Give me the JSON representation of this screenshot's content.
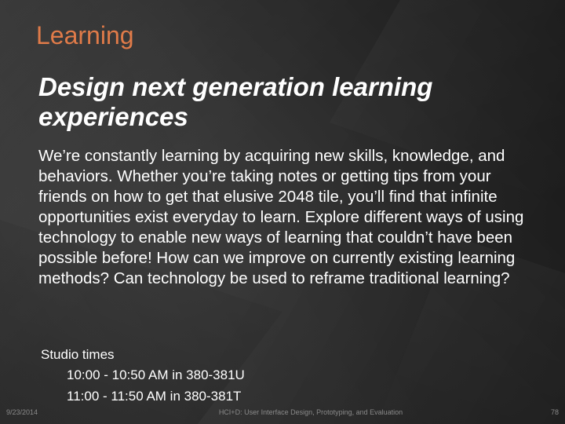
{
  "slide": {
    "section_title": "Learning",
    "headline": "Design next generation learning experiences",
    "body": "We’re constantly learning by acquiring new skills, knowledge, and behaviors. Whether you’re taking notes or getting tips from your friends on how to get that elusive 2048 tile, you’ll find that infinite opportunities exist everyday to learn. Explore different ways of using technology to enable new ways of learning that couldn’t have been possible before! How can we improve on currently existing learning methods? Can technology be used to reframe traditional learning?",
    "studio": {
      "label": "Studio times",
      "times": [
        "10:00 - 10:50 AM in 380-381U",
        "11:00 - 11:50 AM in 380-381T"
      ]
    }
  },
  "footer": {
    "date": "9/23/2014",
    "course": "HCI+D: User Interface Design, Prototyping, and Evaluation",
    "page_number": "78"
  },
  "colors": {
    "accent": "#e07b49",
    "text": "#ffffff",
    "footer_text": "#8a8a8a",
    "background": "#2f2f2f"
  }
}
